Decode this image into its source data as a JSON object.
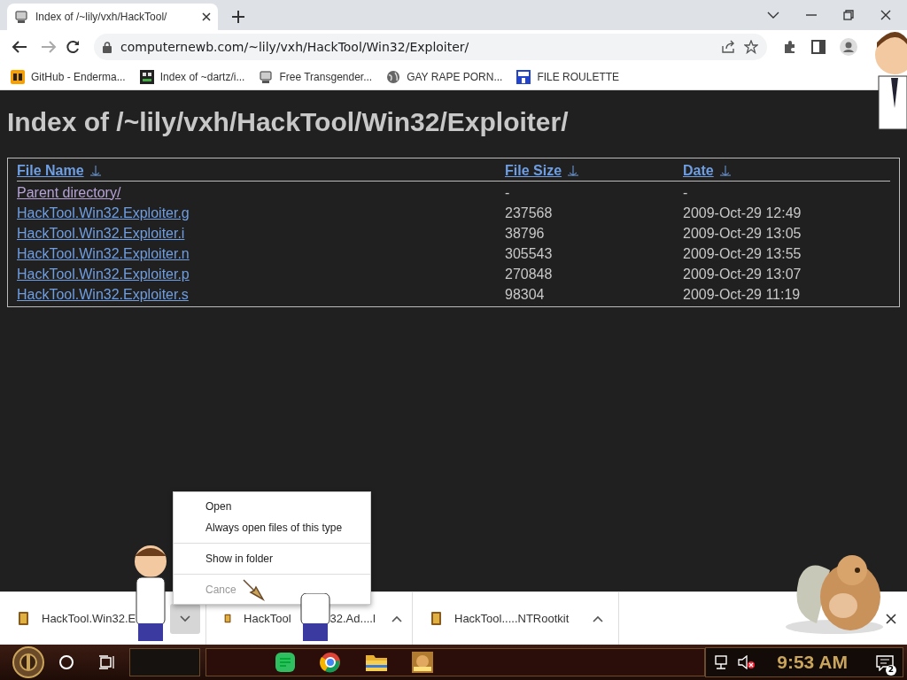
{
  "tab": {
    "title": "Index of /~lily/vxh/HackTool/",
    "selected": true
  },
  "address": {
    "url": "computernewb.com/~lily/vxh/HackTool/Win32/Exploiter/",
    "forward_disabled": true
  },
  "bookmarks": [
    {
      "label": "GitHub - Enderma...",
      "kind": "ph"
    },
    {
      "label": "Index of ~dartz/i...",
      "kind": "grid"
    },
    {
      "label": "Free Transgender...",
      "kind": "pc"
    },
    {
      "label": "GAY RAPE PORN...",
      "kind": "globe"
    },
    {
      "label": "FILE ROULETTE",
      "kind": "mft"
    }
  ],
  "page": {
    "heading": "Index of /~lily/vxh/HackTool/Win32/Exploiter/",
    "columns": [
      "File Name",
      "File Size",
      "Date"
    ],
    "rows": [
      {
        "name": "Parent directory/",
        "size": "-",
        "date": "-",
        "visited": true
      },
      {
        "name": "HackTool.Win32.Exploiter.g",
        "size": "237568",
        "date": "2009-Oct-29 12:49",
        "visited": false
      },
      {
        "name": "HackTool.Win32.Exploiter.i",
        "size": "38796",
        "date": "2009-Oct-29 13:05",
        "visited": false
      },
      {
        "name": "HackTool.Win32.Exploiter.n",
        "size": "305543",
        "date": "2009-Oct-29 13:55",
        "visited": false
      },
      {
        "name": "HackTool.Win32.Exploiter.p",
        "size": "270848",
        "date": "2009-Oct-29 13:07",
        "visited": false
      },
      {
        "name": "HackTool.Win32.Exploiter.s",
        "size": "98304",
        "date": "2009-Oct-29 11:19",
        "visited": false
      }
    ]
  },
  "context_menu": {
    "items": [
      {
        "label": "Open",
        "disabled": false,
        "separator_before": false
      },
      {
        "label": "Always open files of this type",
        "disabled": false,
        "separator_before": false
      },
      {
        "label": "Show in folder",
        "disabled": false,
        "separator_before": true
      },
      {
        "label": "Cance",
        "disabled": true,
        "separator_before": true
      }
    ]
  },
  "downloads": [
    {
      "name_parts": [
        "HackTool.Win32.E"
      ],
      "menu_open": true
    },
    {
      "name_parts": [
        "HackTool",
        "32.Ad....l"
      ],
      "menu_open": false
    },
    {
      "name_parts": [
        "HackTool.....NTRootkit"
      ],
      "menu_open": false
    }
  ],
  "taskbar": {
    "time": "9:53 AM",
    "notifications": "2",
    "volume_muted": true
  }
}
